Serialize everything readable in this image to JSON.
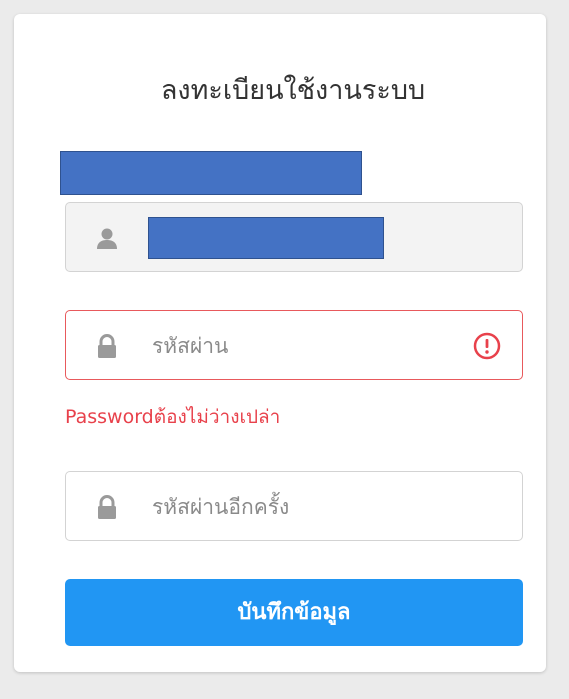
{
  "form": {
    "title": "ลงทะเบียนใช้งานระบบ",
    "password_placeholder": "รหัสผ่าน",
    "password_error": "Passwordต้องไม่ว่างเปล่า",
    "confirm_placeholder": "รหัสผ่านอีกครั้ง",
    "submit_label": "บันทึกข้อมูล"
  },
  "icons": {
    "user": "user-icon",
    "lock": "lock-icon",
    "alert": "alert-circle-icon"
  },
  "colors": {
    "accent": "#2196f3",
    "error": "#e8414b",
    "redaction": "#4472c4"
  }
}
